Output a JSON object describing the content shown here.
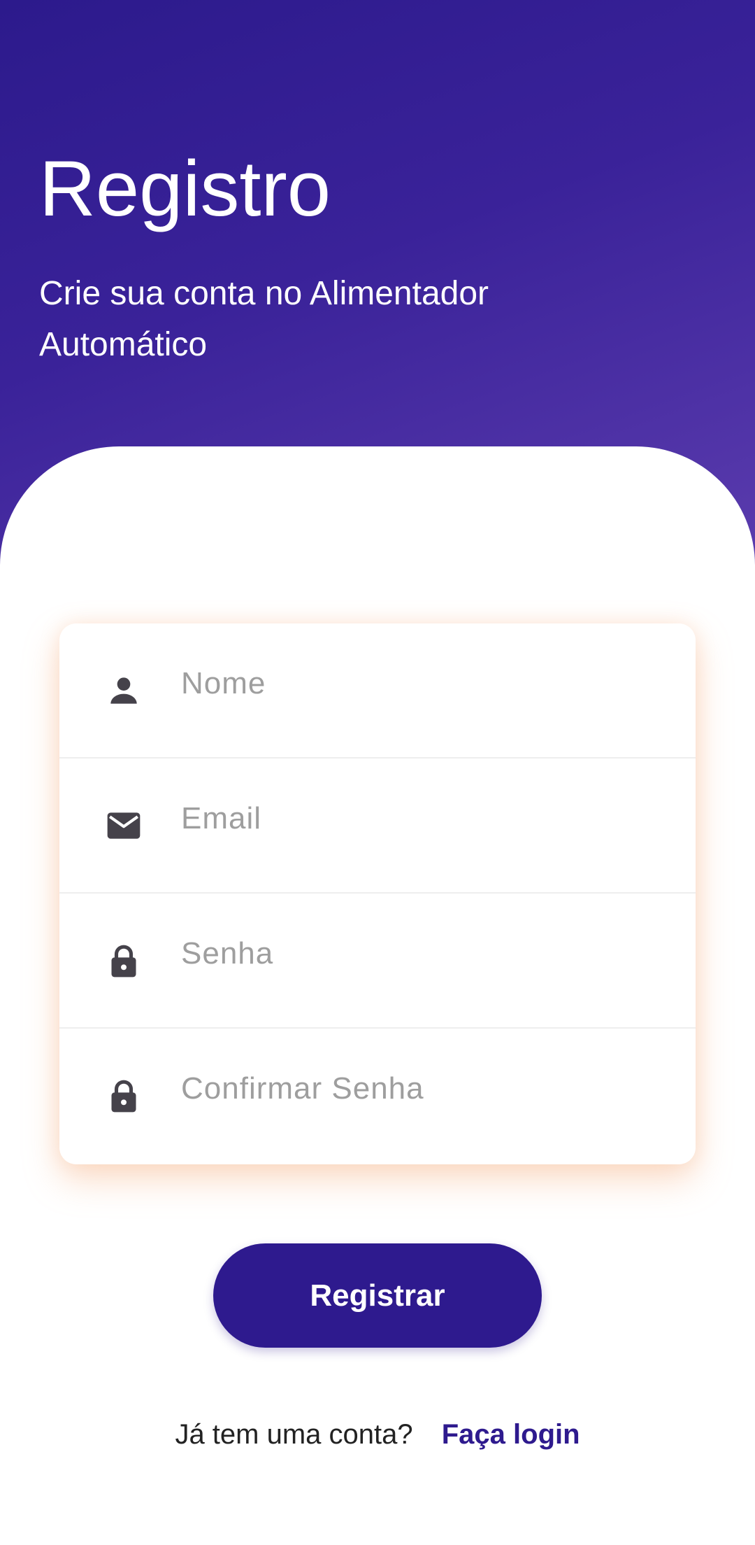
{
  "header": {
    "title": "Registro",
    "subtitle": "Crie sua conta no Alimentador Automático"
  },
  "form": {
    "fields": [
      {
        "icon": "person-icon",
        "placeholder": "Nome"
      },
      {
        "icon": "mail-icon",
        "placeholder": "Email"
      },
      {
        "icon": "lock-icon",
        "placeholder": "Senha"
      },
      {
        "icon": "lock-icon",
        "placeholder": "Confirmar Senha"
      }
    ]
  },
  "actions": {
    "register_label": "Registrar"
  },
  "footer": {
    "question": "Já tem uma conta?",
    "login_link": "Faça login"
  },
  "colors": {
    "primary": "#2e1a8e",
    "header_gradient_start": "#2c1a8c",
    "header_gradient_end": "#5b3cae",
    "icon": "#45424a",
    "placeholder": "#9e9e9e",
    "card_glow": "#f4aa78"
  }
}
